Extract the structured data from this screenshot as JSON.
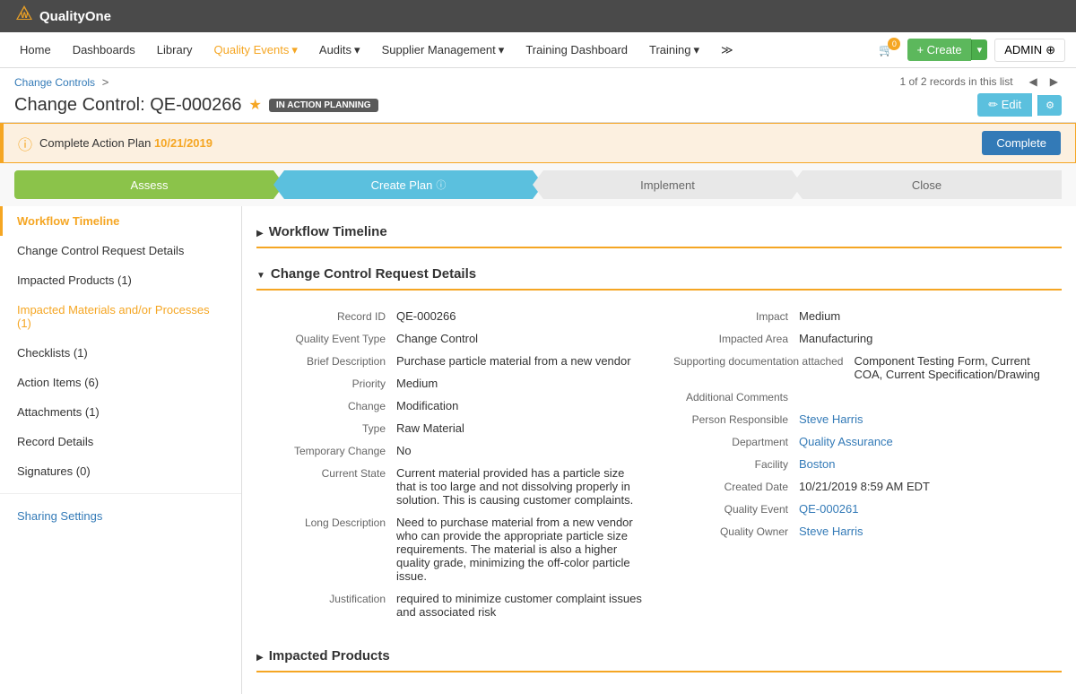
{
  "topBar": {
    "logoIcon": "▼",
    "logoText": "QualityOne"
  },
  "mainNav": {
    "items": [
      {
        "label": "Home",
        "active": false
      },
      {
        "label": "Dashboards",
        "active": false
      },
      {
        "label": "Library",
        "active": false
      },
      {
        "label": "Quality Events",
        "active": true,
        "hasArrow": true
      },
      {
        "label": "Audits",
        "active": false,
        "hasArrow": true
      },
      {
        "label": "Supplier Management",
        "active": false,
        "hasArrow": true
      },
      {
        "label": "Training Dashboard",
        "active": false
      },
      {
        "label": "Training",
        "active": false,
        "hasArrow": true
      }
    ],
    "moreIcon": "≫",
    "cartIcon": "🛒",
    "cartCount": "0",
    "createLabel": "+ Create",
    "adminLabel": "ADMIN"
  },
  "breadcrumb": {
    "label": "Change Controls",
    "separator": ">",
    "recordInfo": "1 of 2 records in this list"
  },
  "pageTitle": {
    "title": "Change Control: QE-000266",
    "starIcon": "★",
    "statusBadge": "IN ACTION PLANNING",
    "editLabel": "✏ Edit",
    "gearIcon": "⚙"
  },
  "alertBar": {
    "icon": "ⓘ",
    "text": "Complete Action Plan",
    "date": "10/21/2019",
    "completeLabel": "Complete"
  },
  "workflowSteps": [
    {
      "label": "Assess",
      "style": "assess"
    },
    {
      "label": "Create Plan",
      "style": "create",
      "hasInfo": true
    },
    {
      "label": "Implement",
      "style": "implement"
    },
    {
      "label": "Close",
      "style": "close"
    }
  ],
  "sidebar": {
    "items": [
      {
        "label": "Workflow Timeline",
        "active": true,
        "id": "workflow-timeline"
      },
      {
        "label": "Change Control Request Details",
        "active": false,
        "id": "request-details"
      },
      {
        "label": "Impacted Products (1)",
        "active": false,
        "id": "impacted-products"
      },
      {
        "label": "Impacted Materials and/or Processes (1)",
        "active": false,
        "id": "impacted-materials",
        "isLink": true
      },
      {
        "label": "Checklists (1)",
        "active": false,
        "id": "checklists"
      },
      {
        "label": "Action Items (6)",
        "active": false,
        "id": "action-items"
      },
      {
        "label": "Attachments (1)",
        "active": false,
        "id": "attachments"
      },
      {
        "label": "Record Details",
        "active": false,
        "id": "record-details"
      },
      {
        "label": "Signatures (0)",
        "active": false,
        "id": "signatures"
      }
    ],
    "sharingLabel": "Sharing Settings"
  },
  "sections": {
    "workflowTimeline": {
      "title": "Workflow Timeline"
    },
    "requestDetails": {
      "title": "Change Control Request Details",
      "leftFields": [
        {
          "label": "Record ID",
          "value": "QE-000266",
          "isLink": false
        },
        {
          "label": "Quality Event Type",
          "value": "Change Control",
          "isLink": false
        },
        {
          "label": "Brief Description",
          "value": "Purchase particle material from a new vendor",
          "isLink": false
        },
        {
          "label": "Priority",
          "value": "Medium",
          "isLink": false
        },
        {
          "label": "Change",
          "value": "Modification",
          "isLink": false
        },
        {
          "label": "Type",
          "value": "Raw Material",
          "isLink": false
        },
        {
          "label": "Temporary Change",
          "value": "No",
          "isLink": false
        },
        {
          "label": "Current State",
          "value": "Current material provided has a particle size that is too large and not dissolving properly in solution.  This is causing customer complaints.",
          "isLink": false
        },
        {
          "label": "Long Description",
          "value": "Need to purchase material from a new vendor who can provide the appropriate particle size requirements.  The material is also a higher quality grade, minimizing the off-color particle issue.",
          "isLink": false
        },
        {
          "label": "Justification",
          "value": "required to minimize customer complaint issues and associated risk",
          "isLink": false
        }
      ],
      "rightFields": [
        {
          "label": "Impact",
          "value": "Medium",
          "isLink": false
        },
        {
          "label": "Impacted Area",
          "value": "Manufacturing",
          "isLink": false
        },
        {
          "label": "Supporting documentation attached",
          "value": "Component Testing Form, Current COA, Current Specification/Drawing",
          "isLink": false
        },
        {
          "label": "Additional Comments",
          "value": "",
          "isLink": false
        },
        {
          "label": "Person Responsible",
          "value": "Steve Harris",
          "isLink": true
        },
        {
          "label": "Department",
          "value": "Quality Assurance",
          "isLink": true
        },
        {
          "label": "Facility",
          "value": "Boston",
          "isLink": true
        },
        {
          "label": "Created Date",
          "value": "10/21/2019 8:59 AM EDT",
          "isLink": false
        },
        {
          "label": "Quality Event",
          "value": "QE-000261",
          "isLink": true
        },
        {
          "label": "Quality Owner",
          "value": "Steve Harris",
          "isLink": true
        }
      ]
    },
    "impactedProducts": {
      "title": "Impacted Products"
    }
  }
}
